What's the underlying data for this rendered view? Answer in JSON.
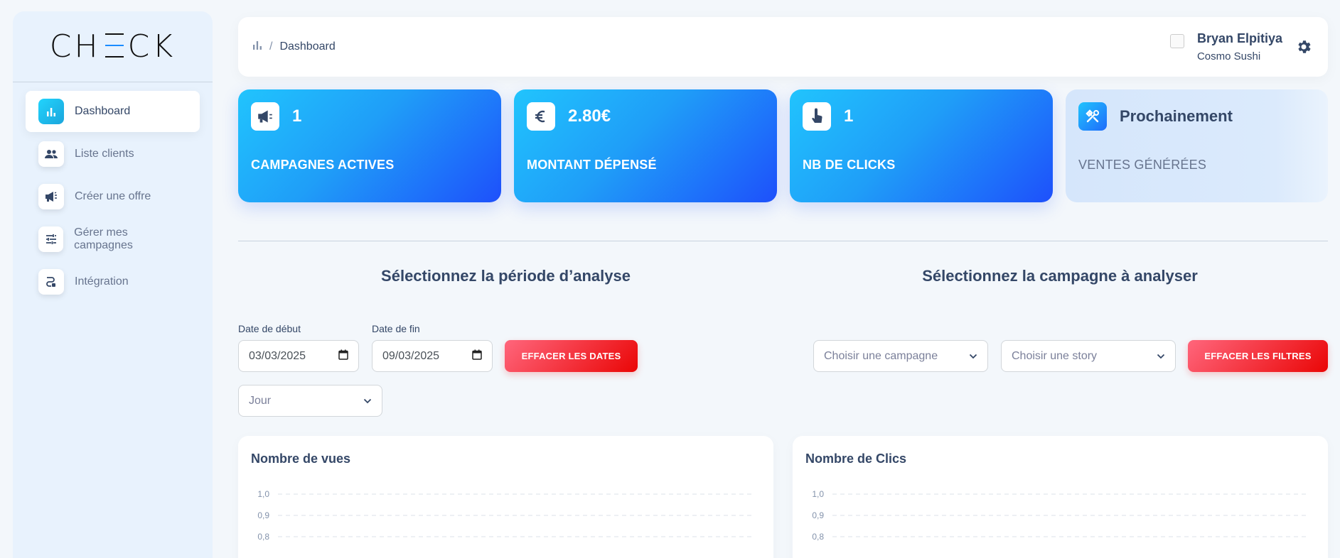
{
  "sidebar": {
    "logo": {
      "pre": "CH",
      "post": "CK"
    },
    "items": [
      {
        "label": "Dashboard",
        "icon": "bar-chart-icon",
        "active": true
      },
      {
        "label": "Liste clients",
        "icon": "people-icon"
      },
      {
        "label": "Créer une offre",
        "icon": "megaphone-icon"
      },
      {
        "label": "Gérer mes campagnes",
        "icon": "sliders-icon"
      },
      {
        "label": "Intégration",
        "icon": "integration-icon"
      }
    ]
  },
  "header": {
    "breadcrumb": {
      "sep": "/",
      "current": "Dashboard"
    },
    "user": {
      "name": "Bryan Elpitiya",
      "company": "Cosmo Sushi"
    }
  },
  "stats": [
    {
      "value": "1",
      "label": "CAMPAGNES ACTIVES",
      "icon": "megaphone-icon"
    },
    {
      "value": "2.80€",
      "label": "MONTANT DÉPENSÉ",
      "icon": "euro-icon"
    },
    {
      "value": "1",
      "label": "NB DE CLICKS",
      "icon": "pointer-hand-icon"
    },
    {
      "value": "Prochainement",
      "label": "VENTES GÉNÉRÉES",
      "icon": "tools-icon"
    }
  ],
  "period": {
    "title": "Sélectionnez la période d’analyse",
    "start_label": "Date de début",
    "start_value": "03/03/2025",
    "end_label": "Date de fin",
    "end_value": "09/03/2025",
    "clear_button": "EFFACER LES DATES",
    "granularity": "Jour"
  },
  "campaign": {
    "title": "Sélectionnez la campagne à analyser",
    "campaign_placeholder": "Choisir une campagne",
    "story_placeholder": "Choisir une story",
    "clear_button": "EFFACER LES FILTRES"
  },
  "colors": {
    "accent": "#1e50fb",
    "danger": "#ea0606",
    "text": "#344767"
  },
  "chart_data": [
    {
      "type": "line",
      "title": "Nombre de vues",
      "y_ticks": [
        "1,0",
        "0,9",
        "0,8"
      ],
      "ylim": [
        0,
        1
      ],
      "series": [],
      "grid": true
    },
    {
      "type": "line",
      "title": "Nombre de Clics",
      "y_ticks": [
        "1,0",
        "0,9",
        "0,8"
      ],
      "ylim": [
        0,
        1
      ],
      "series": [],
      "grid": true
    }
  ]
}
